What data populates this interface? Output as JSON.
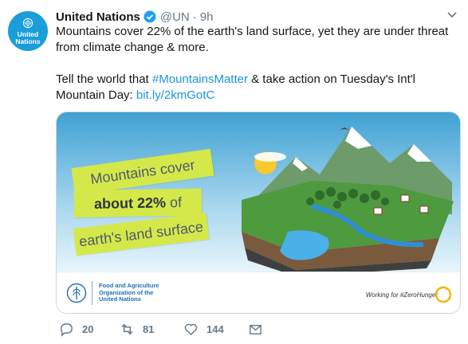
{
  "tweet": {
    "avatar_text": [
      "United",
      "Nations"
    ],
    "author_name": "United Nations",
    "handle": "@UN",
    "separator": "·",
    "time": "9h",
    "text_line1": "Mountains cover 22% of the earth's land surface, yet they are under threat from climate change & more.",
    "text_line2_pre": "Tell the world that ",
    "hashtag": "#MountainsMatter",
    "text_line2_mid": " & take action on Tuesday's Int'l Mountain Day: ",
    "link": "bit.ly/2kmGotC"
  },
  "card": {
    "banner1": "Mountains cover",
    "banner2_bold": "about 22%",
    "banner2_rest": "of",
    "banner3": "earth's land surface",
    "fao_lines": [
      "Food and Agriculture",
      "Organization of the",
      "United Nations"
    ],
    "zero_hunger": "Working for #ZeroHunger"
  },
  "actions": {
    "reply_count": "20",
    "retweet_count": "81",
    "like_count": "144"
  },
  "colors": {
    "link": "#1b95e0",
    "banner": "#d5e84a",
    "avatar": "#1a9ed9",
    "muted": "#657786"
  }
}
